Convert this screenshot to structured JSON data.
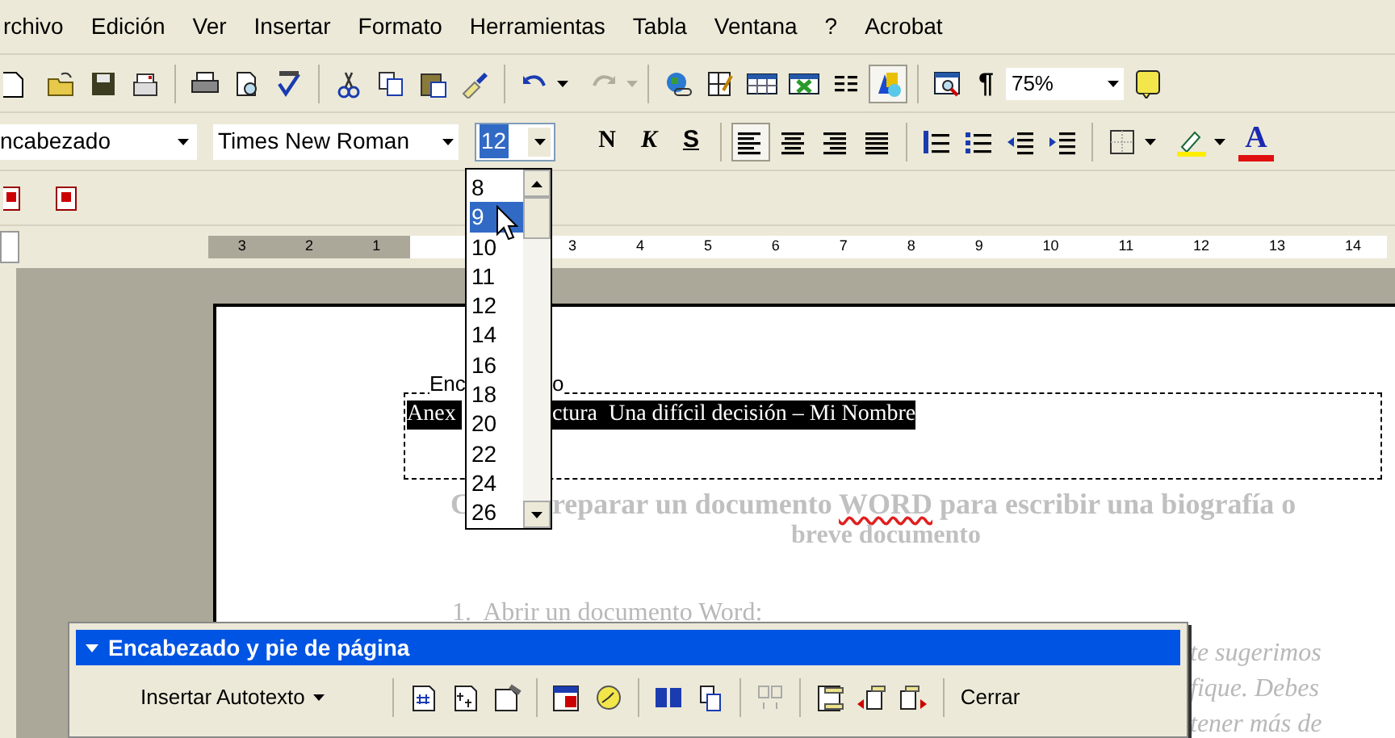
{
  "menu": [
    {
      "label": "rchivo"
    },
    {
      "label": "Edición"
    },
    {
      "label": "Ver"
    },
    {
      "label": "Insertar"
    },
    {
      "label": "Formato"
    },
    {
      "label": "Herramientas"
    },
    {
      "label": "Tabla"
    },
    {
      "label": "Ventana"
    },
    {
      "label": "?"
    },
    {
      "label": "Acrobat"
    }
  ],
  "standard_toolbar": {
    "show_marks_label": "¶",
    "zoom": "75%",
    "drawing_pressed": true,
    "redo_disabled": true
  },
  "formatting_toolbar": {
    "style": "ncabezado",
    "font": "Times New Roman",
    "size": "12",
    "bold_label": "N",
    "italic_label": "K",
    "underline_label": "S",
    "font_color_label": "A",
    "alignments": [
      {
        "kind": "left",
        "selected": true
      },
      {
        "kind": "center",
        "selected": false
      },
      {
        "kind": "right",
        "selected": false
      },
      {
        "kind": "justify",
        "selected": false
      }
    ]
  },
  "size_dropdown": {
    "options": [
      {
        "label": "8",
        "selected": false
      },
      {
        "label": "9",
        "selected": true
      },
      {
        "label": "10",
        "selected": false
      },
      {
        "label": "11",
        "selected": false
      },
      {
        "label": "12",
        "selected": false
      },
      {
        "label": "14",
        "selected": false
      },
      {
        "label": "16",
        "selected": false
      },
      {
        "label": "18",
        "selected": false
      },
      {
        "label": "20",
        "selected": false
      },
      {
        "label": "22",
        "selected": false
      },
      {
        "label": "24",
        "selected": false
      },
      {
        "label": "26",
        "selected": false
      }
    ]
  },
  "ruler": {
    "left_numbers": [
      "3",
      "2",
      "1"
    ],
    "right_numbers": [
      "3",
      "4",
      "5",
      "6",
      "7",
      "8",
      "9",
      "10",
      "11",
      "12",
      "13",
      "14"
    ]
  },
  "document": {
    "header_label_parts": [
      "Enc",
      "o"
    ],
    "header_text_parts": [
      "Anex",
      "ctura  Una difícil decisión – Mi Nombre"
    ],
    "title_first": "C",
    "title_segments": [
      {
        "text": "reparar un documento ",
        "misspelled": false
      },
      {
        "text": "WORD",
        "misspelled": true
      },
      {
        "text": " para escribir una biografía o",
        "misspelled": false
      }
    ],
    "title_line2": "breve documento",
    "step": "1.  Abrir un documento Word:",
    "body_lines": [
      "te sugerimos",
      "fique. Debes",
      "tener más de"
    ]
  },
  "header_footer_toolbar": {
    "title": "Encabezado y pie de página",
    "autotext_button": "Insertar Autotexto",
    "close_button": "Cerrar"
  }
}
